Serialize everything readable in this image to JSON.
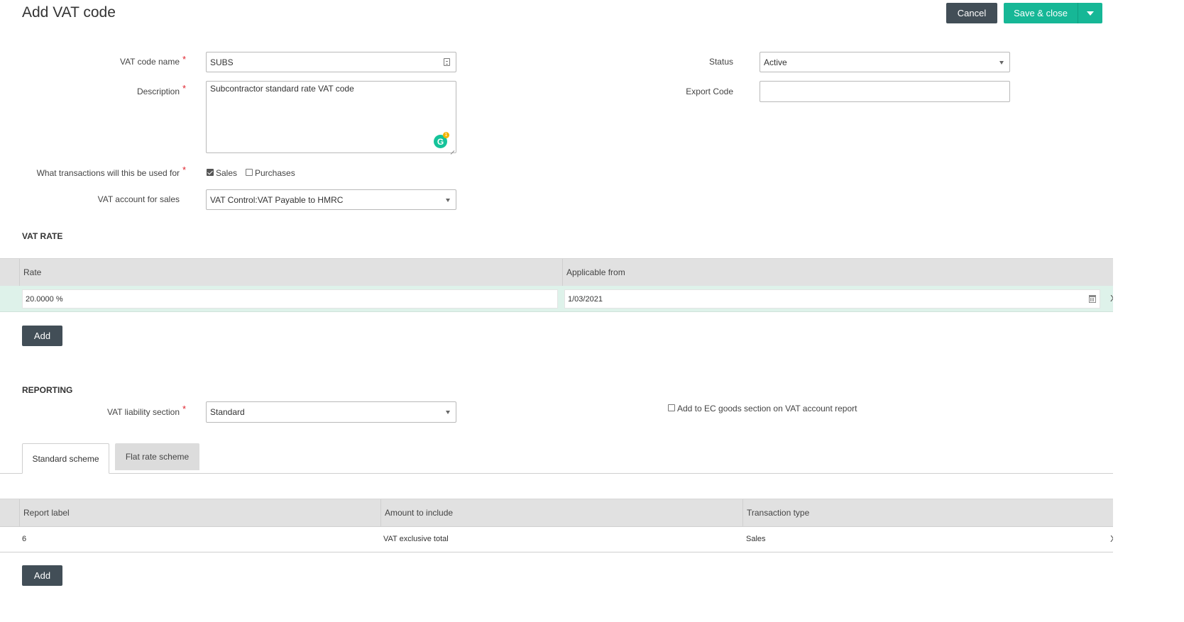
{
  "header": {
    "title": "Add VAT code",
    "cancel_label": "Cancel",
    "save_label": "Save & close"
  },
  "form": {
    "vat_code_name": {
      "label": "VAT code name",
      "value": "SUBS"
    },
    "description": {
      "label": "Description",
      "value": "Subcontractor standard rate VAT code"
    },
    "grammarly": {
      "letter": "G",
      "count": "1"
    },
    "transactions": {
      "label": "What transactions will this be used for",
      "sales_label": "Sales",
      "sales_checked": true,
      "purchases_label": "Purchases",
      "purchases_checked": false
    },
    "vat_account_sales": {
      "label": "VAT account for sales",
      "value": "VAT Control:VAT Payable to HMRC"
    },
    "status": {
      "label": "Status",
      "value": "Active"
    },
    "export_code": {
      "label": "Export Code",
      "value": ""
    }
  },
  "vat_rate": {
    "section_title": "VAT RATE",
    "columns": [
      "Rate",
      "Applicable from"
    ],
    "rows": [
      {
        "rate": "20.0000 %",
        "applicable_from": "1/03/2021"
      }
    ],
    "add_label": "Add"
  },
  "reporting": {
    "section_title": "REPORTING",
    "liability_label": "VAT liability section",
    "liability_value": "Standard",
    "ec_goods_label": "Add to EC goods section on VAT account report",
    "ec_goods_checked": false,
    "tabs": [
      "Standard scheme",
      "Flat rate scheme"
    ],
    "active_tab": "Standard scheme",
    "columns": [
      "Report label",
      "Amount to include",
      "Transaction type"
    ],
    "rows": [
      {
        "report_label": "6",
        "amount": "VAT exclusive total",
        "transaction_type": "Sales"
      }
    ],
    "add_label": "Add"
  },
  "required_marker": "*",
  "row_close_glyph": "X",
  "colors": {
    "primary": "#16b796",
    "dark_button": "#424e57",
    "required": "#e0242e",
    "selected_row": "#def2ea"
  }
}
